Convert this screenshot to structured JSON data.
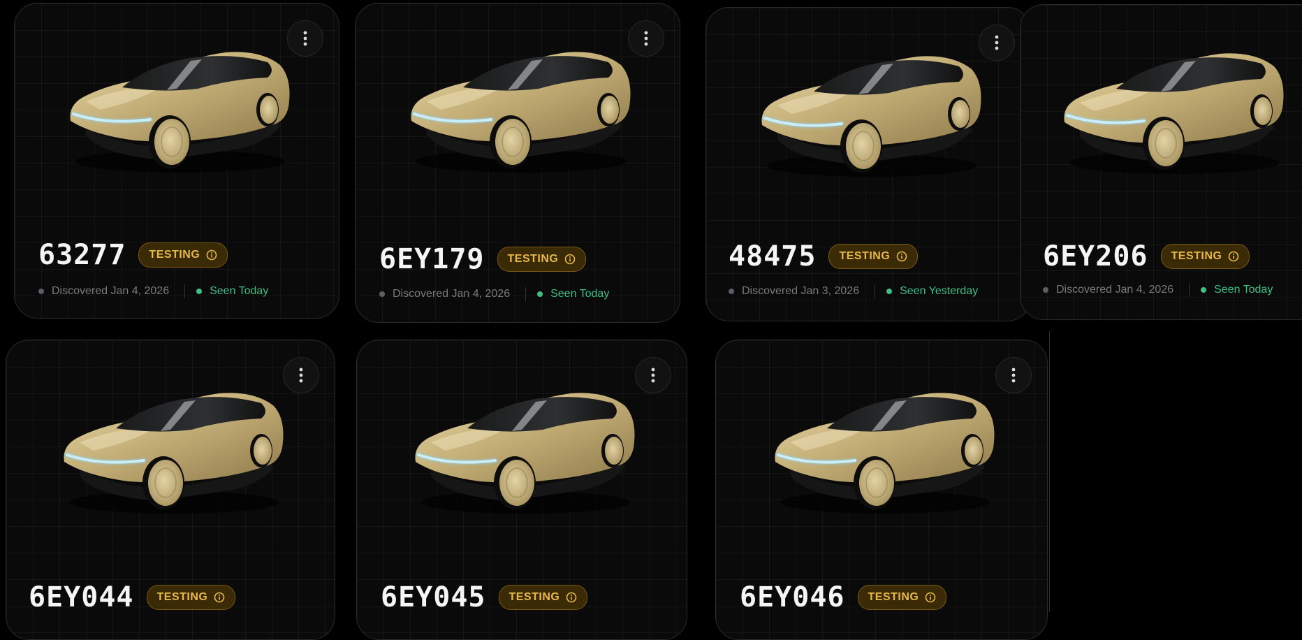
{
  "colors": {
    "badge_text": "#e8b84a",
    "badge_bg": "#3a2a05",
    "seen_green": "#3fbf86",
    "discovered_gray": "#7a7a7a",
    "car_gold": "#c8b37a"
  },
  "icons": {
    "menu": "vertical-dots-icon",
    "badge": "info-icon"
  },
  "vehicles": [
    {
      "id": "63277",
      "status": "TESTING",
      "discovered": "Discovered Jan 4, 2026",
      "seen": "Seen Today"
    },
    {
      "id": "6EY179",
      "status": "TESTING",
      "discovered": "Discovered Jan 4, 2026",
      "seen": "Seen Today"
    },
    {
      "id": "48475",
      "status": "TESTING",
      "discovered": "Discovered Jan 3, 2026",
      "seen": "Seen Yesterday"
    },
    {
      "id": "6EY206",
      "status": "TESTING",
      "discovered": "Discovered Jan 4, 2026",
      "seen": "Seen Today"
    },
    {
      "id": "6EY044",
      "status": "TESTING"
    },
    {
      "id": "6EY045",
      "status": "TESTING"
    },
    {
      "id": "6EY046",
      "status": "TESTING"
    }
  ]
}
